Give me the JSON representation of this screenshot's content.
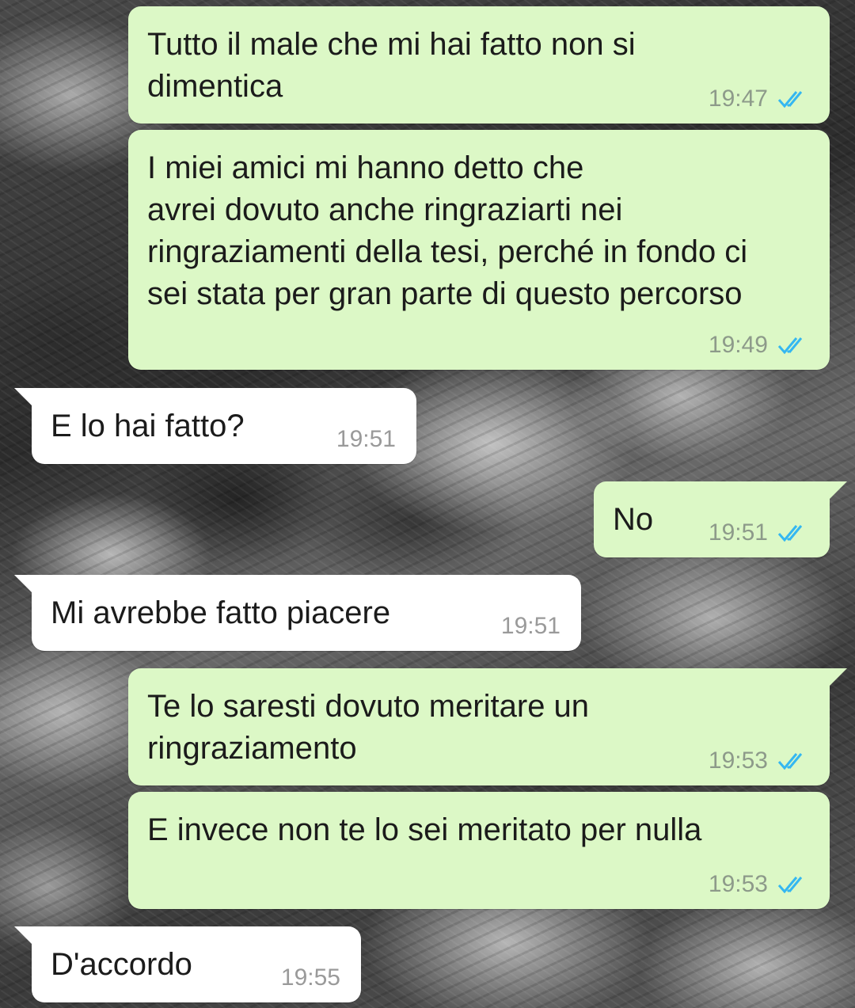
{
  "colors": {
    "outgoing_bubble": "#dcf8c6",
    "incoming_bubble": "#ffffff",
    "read_ticks": "#34b7f1"
  },
  "icons": {
    "read_status": "double-check-read-icon"
  },
  "messages": [
    {
      "direction": "outgoing",
      "text": "Tutto il male che mi hai fatto non si\ndimentica",
      "time": "19:47",
      "status": "read"
    },
    {
      "direction": "outgoing",
      "text": "I miei amici mi hanno detto che\navrei dovuto anche ringraziarti nei\nringraziamenti della tesi, perché in fondo ci\nsei stata per gran parte di questo percorso",
      "time": "19:49",
      "status": "read"
    },
    {
      "direction": "incoming",
      "text": "E lo hai fatto?",
      "time": "19:51"
    },
    {
      "direction": "outgoing",
      "text": "No",
      "time": "19:51",
      "status": "read"
    },
    {
      "direction": "incoming",
      "text": "Mi avrebbe fatto piacere",
      "time": "19:51"
    },
    {
      "direction": "outgoing",
      "text": "Te lo saresti dovuto meritare un\nringraziamento",
      "time": "19:53",
      "status": "read"
    },
    {
      "direction": "outgoing",
      "text": "E invece non te lo sei meritato per nulla",
      "time": "19:53",
      "status": "read"
    },
    {
      "direction": "incoming",
      "text": "D'accordo",
      "time": "19:55"
    }
  ]
}
